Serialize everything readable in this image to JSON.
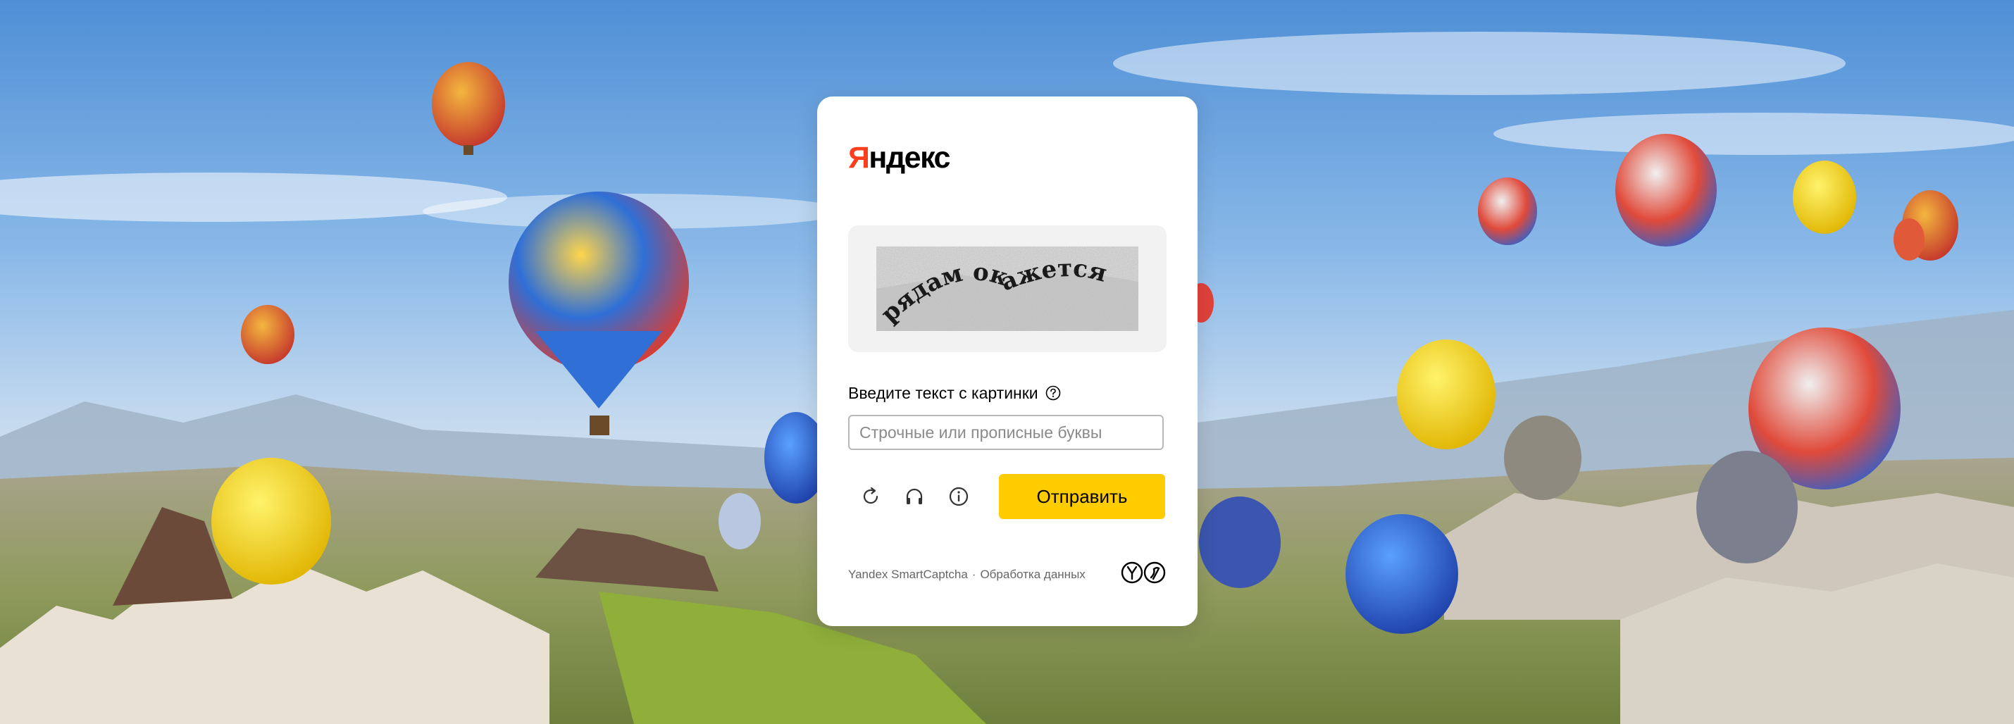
{
  "logo": {
    "first_letter": "Я",
    "rest": "ндекс"
  },
  "captcha": {
    "text": "рядам окажется"
  },
  "form": {
    "label": "Введите текст с картинки",
    "input_placeholder": "Строчные или прописные буквы",
    "input_value": "",
    "submit_label": "Отправить"
  },
  "icons": {
    "help": "question-circle-icon",
    "reload": "reload-icon",
    "audio": "headphones-icon",
    "info": "info-icon",
    "footer_logo": "yandex-smartcaptcha-logo"
  },
  "footer": {
    "product": "Yandex SmartCaptcha",
    "separator": "·",
    "data_link": "Обработка данных"
  },
  "colors": {
    "logo_red": "#fc3f1d",
    "submit_yellow": "#ffcc00",
    "card_bg": "#ffffff",
    "captcha_box_bg": "#f2f2f2"
  }
}
